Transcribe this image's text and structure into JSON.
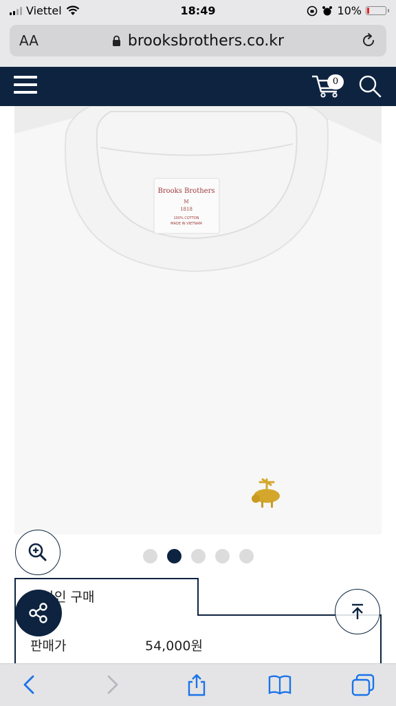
{
  "status_bar": {
    "carrier": "Viettel",
    "time": "18:49",
    "battery": "10%"
  },
  "url_bar": {
    "text_size_label": "AA",
    "domain": "brooksbrothers.co.kr"
  },
  "site_nav": {
    "cart_count": "0"
  },
  "product": {
    "label_brand": "Brooks Brothers",
    "label_size": "M",
    "label_year": "1818",
    "label_line1": "100% COTTON",
    "label_line2": "MADE IN VIETNAM"
  },
  "carousel": {
    "dot_count": 5,
    "active_index": 1
  },
  "purchase": {
    "online_label": "온라인 구매",
    "price_label": "판매가",
    "price_value": "54,000원"
  },
  "colors": {
    "navy": "#0d2340",
    "ios_blue": "#1a73e8",
    "gold": "#d4a72c"
  }
}
